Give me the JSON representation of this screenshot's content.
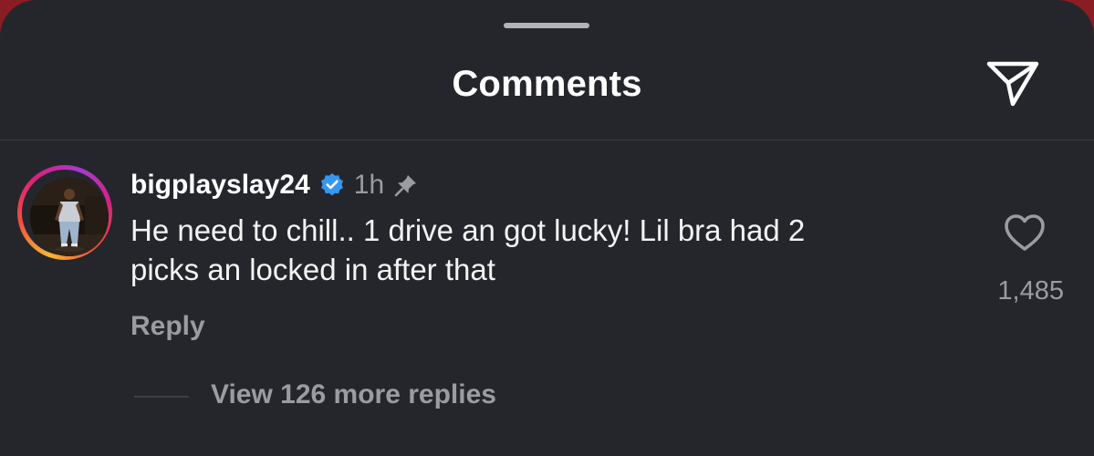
{
  "header": {
    "title": "Comments",
    "share_icon": "paper-plane-icon"
  },
  "comment": {
    "username": "bigplayslay24",
    "verified_icon": "verified-badge-icon",
    "time": "1h",
    "pin_icon": "pin-icon",
    "text": "He need to chill.. 1 drive an got lucky! Lil bra had 2\npicks an locked in after that",
    "reply_label": "Reply",
    "like_icon": "heart-outline-icon",
    "like_count": "1,485",
    "view_replies_label": "View 126 more replies"
  },
  "colors": {
    "background": "#25262b",
    "text_primary": "#ffffff",
    "text_secondary": "#9a9ca3",
    "verified_blue": "#3797f0"
  }
}
